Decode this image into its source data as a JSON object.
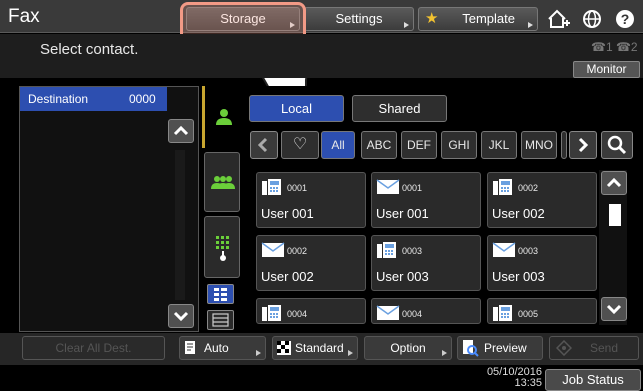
{
  "app_title": "Fax",
  "top_tabs": {
    "storage": "Storage",
    "settings": "Settings",
    "template": "Template"
  },
  "instruction": "Select contact.",
  "line_indicators": "☎1 ☎2",
  "monitor_label": "Monitor",
  "destination": {
    "label": "Destination",
    "count": "0000"
  },
  "source_tabs": {
    "local": "Local",
    "shared": "Shared"
  },
  "index_tabs": [
    "♡",
    "All",
    "ABC",
    "DEF",
    "GHI",
    "JKL",
    "MNO"
  ],
  "contacts": [
    {
      "num": "0001",
      "name": "User 001",
      "type": "fax"
    },
    {
      "num": "0001",
      "name": "User 001",
      "type": "email"
    },
    {
      "num": "0002",
      "name": "User 002",
      "type": "fax"
    },
    {
      "num": "0002",
      "name": "User 002",
      "type": "email"
    },
    {
      "num": "0003",
      "name": "User 003",
      "type": "fax"
    },
    {
      "num": "0003",
      "name": "User 003",
      "type": "email"
    },
    {
      "num": "0004",
      "name": "",
      "type": "fax"
    },
    {
      "num": "0004",
      "name": "",
      "type": "email"
    },
    {
      "num": "0005",
      "name": "",
      "type": "fax"
    }
  ],
  "bottom": {
    "clear_all": "Clear All Dest.",
    "auto": "Auto",
    "standard": "Standard",
    "option": "Option",
    "preview": "Preview",
    "send": "Send"
  },
  "date": "05/10/2016",
  "time": "13:35",
  "job_status": "Job Status",
  "colors": {
    "accent_blue": "#2d4fb0",
    "highlight": "#f29a86",
    "tab_gold": "#c8a630",
    "icon_green": "#6bcf3a"
  }
}
